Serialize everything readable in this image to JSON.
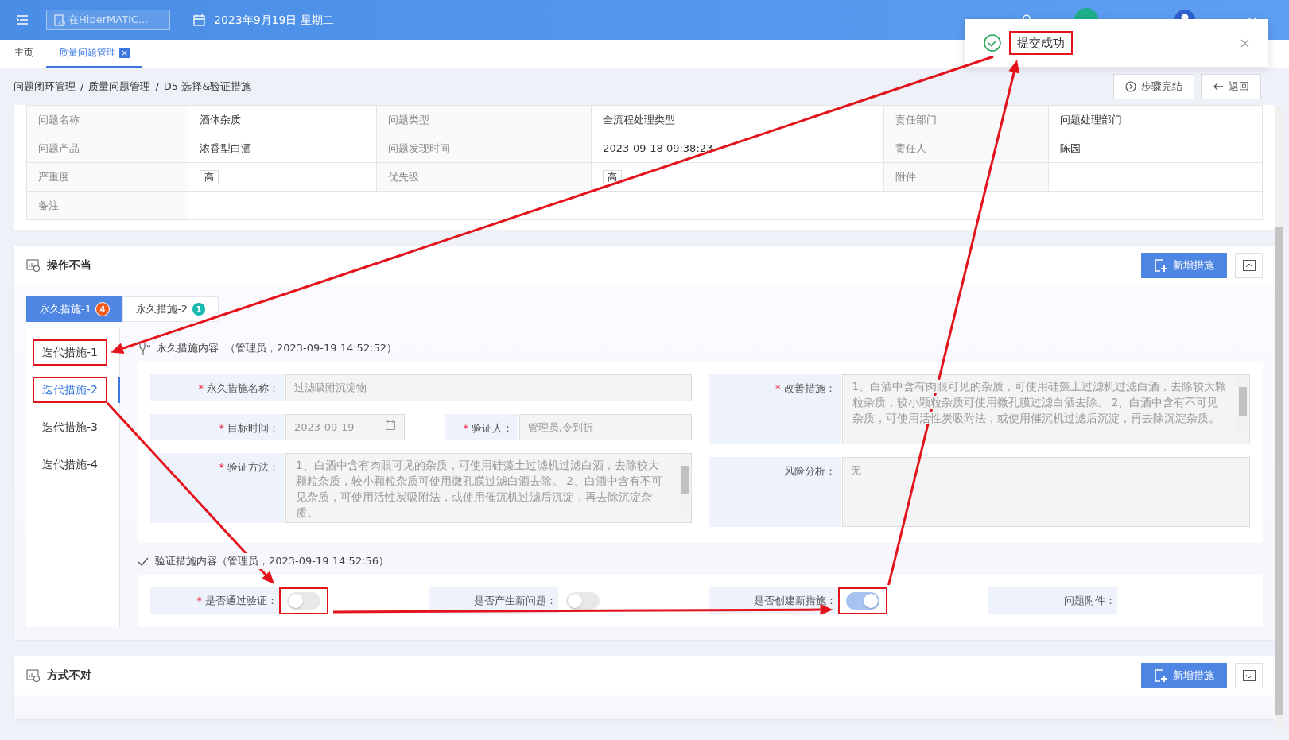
{
  "header": {
    "search_placeholder": "在HiperMATIC...",
    "date": "2023年9月19日 星期二"
  },
  "toast": {
    "message": "提交成功",
    "highlighted": true
  },
  "page_tabs": [
    {
      "label": "主页",
      "selected": false
    },
    {
      "label": "质量问题管理",
      "selected": true,
      "close": "×"
    }
  ],
  "breadcrumb": {
    "separator": "/",
    "items": [
      "问题闭环管理",
      "质量问题管理",
      "D5 选择&验证措施"
    ]
  },
  "actions": [
    {
      "kind": "finish",
      "label": "步骤完结"
    },
    {
      "kind": "back",
      "label": "返回"
    }
  ],
  "info_table": [
    [
      {
        "label": "问题名称",
        "value": "酒体杂质"
      },
      {
        "label": "问题类型",
        "value": "全流程处理类型"
      },
      {
        "label": "责任部门",
        "value": "问题处理部门"
      }
    ],
    [
      {
        "label": "问题产品",
        "value": "浓香型白酒"
      },
      {
        "label": "问题发现时间",
        "value": "2023-09-18 09:38:23"
      },
      {
        "label": "责任人",
        "value": "陈园"
      }
    ],
    [
      {
        "label": "严重度",
        "value": "高",
        "kind": "tag"
      },
      {
        "label": "优先级",
        "value": "高",
        "kind": "tag"
      },
      {
        "label": "附件"
      }
    ],
    [
      {
        "label": "备注",
        "kind": "wide"
      }
    ]
  ],
  "sections": [
    {
      "title": "操作不当",
      "add_button": "新增措施",
      "expanded": true,
      "measure_tabs": [
        {
          "label": "永久措施-1",
          "badge": "4",
          "color": "#f05a1a",
          "selected": true
        },
        {
          "label": "永久措施-2",
          "badge": "1",
          "color": "#17b8b0",
          "selected": false
        }
      ],
      "iterations": [
        {
          "label": "迭代措施-1",
          "selected": false,
          "highlighted": true
        },
        {
          "label": "迭代措施-2",
          "selected": true,
          "highlighted": true
        },
        {
          "label": "迭代措施-3",
          "selected": false,
          "highlighted": false
        },
        {
          "label": "迭代措施-4",
          "selected": false,
          "highlighted": false
        }
      ],
      "content_title": "永久措施内容",
      "content_meta": "（管理员，2023-09-19 14:52:52）",
      "fields": {
        "name": {
          "label": "永久措施名称：",
          "mark": "*",
          "value": "过滤吸附沉淀物"
        },
        "target_time": {
          "label": "目标时间：",
          "mark": "*",
          "value": "2023-09-19"
        },
        "verifier": {
          "label": "验证人：",
          "mark": "*",
          "value": "管理员,令到折"
        },
        "method": {
          "label": "验证方法：",
          "mark": "*",
          "value": "1、白酒中含有肉眼可见的杂质，可使用硅藻土过滤机过滤白酒，去除较大颗粒杂质，较小颗粒杂质可使用微孔膜过滤白酒去除。 2、白酒中含有不可见杂质，可使用活性炭吸附法，或使用催沉机过滤后沉淀，再去除沉淀杂质。"
        },
        "improve": {
          "label": "改善措施：",
          "mark": "*",
          "value": "1、白酒中含有肉眼可见的杂质，可使用硅藻土过滤机过滤白酒，去除较大颗粒杂质，较小颗粒杂质可使用微孔膜过滤白酒去除。 2、白酒中含有不可见杂质，可使用活性炭吸附法，或使用催沉机过滤后沉淀，再去除沉淀杂质。"
        },
        "risk": {
          "label": "风险分析：",
          "value": "无"
        }
      },
      "verify_title": "验证措施内容（管理员，2023-09-19 14:52:56）",
      "switches": [
        {
          "label": "是否通过验证：",
          "mark": "*",
          "on": false,
          "highlighted": true
        },
        {
          "label": "是否产生新问题：",
          "on": false,
          "highlighted": false
        },
        {
          "label": "是否创建新措施：",
          "on": true,
          "highlighted": true
        }
      ],
      "attachment_label": "问题附件："
    },
    {
      "title": "方式不对",
      "add_button": "新增措施",
      "expanded": false
    }
  ]
}
